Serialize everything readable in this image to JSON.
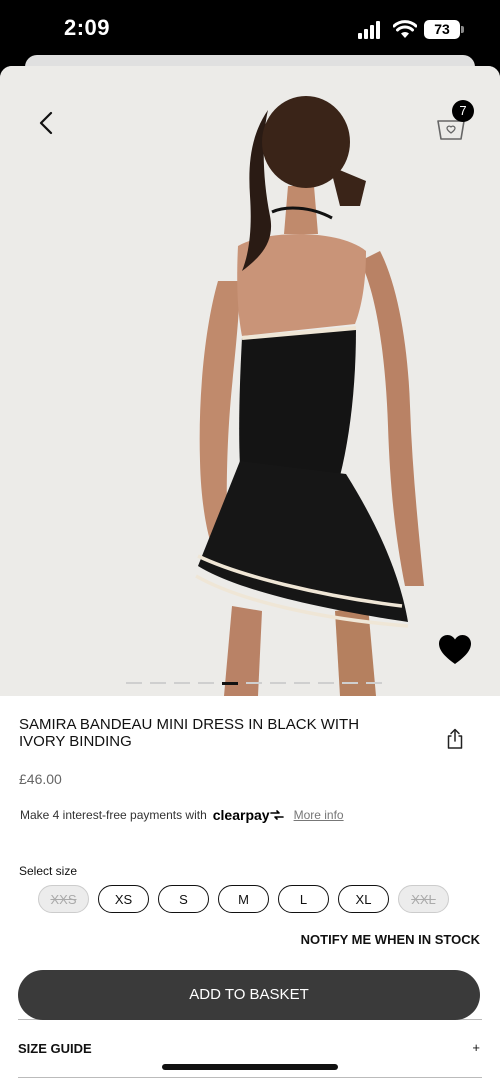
{
  "status_bar": {
    "time": "2:09",
    "battery": "73"
  },
  "header": {
    "basket_count": "7"
  },
  "product": {
    "title": "SAMIRA BANDEAU MINI DRESS IN BLACK WITH IVORY BINDING",
    "price": "£46.00",
    "image_index": 4,
    "image_count": 11
  },
  "clearpay": {
    "text": "Make 4 interest-free payments with",
    "logo": "clearpay",
    "more_info": "More info"
  },
  "sizes": {
    "label": "Select size",
    "options": [
      {
        "label": "XXS",
        "available": false
      },
      {
        "label": "XS",
        "available": true
      },
      {
        "label": "S",
        "available": true
      },
      {
        "label": "M",
        "available": true
      },
      {
        "label": "L",
        "available": true
      },
      {
        "label": "XL",
        "available": true
      },
      {
        "label": "XXL",
        "available": false
      }
    ]
  },
  "notify_label": "NOTIFY ME WHEN IN STOCK",
  "add_to_basket": "ADD TO BASKET",
  "size_guide": {
    "label": "SIZE GUIDE",
    "toggle": "+"
  },
  "colors": {
    "button_bg": "#3a3a3a",
    "hero_bg": "#ecebe8",
    "accent": "#000000"
  },
  "icons": [
    "back-chevron-icon",
    "basket-icon",
    "heart-icon",
    "share-icon",
    "signal-icon",
    "wifi-icon",
    "battery-icon"
  ]
}
